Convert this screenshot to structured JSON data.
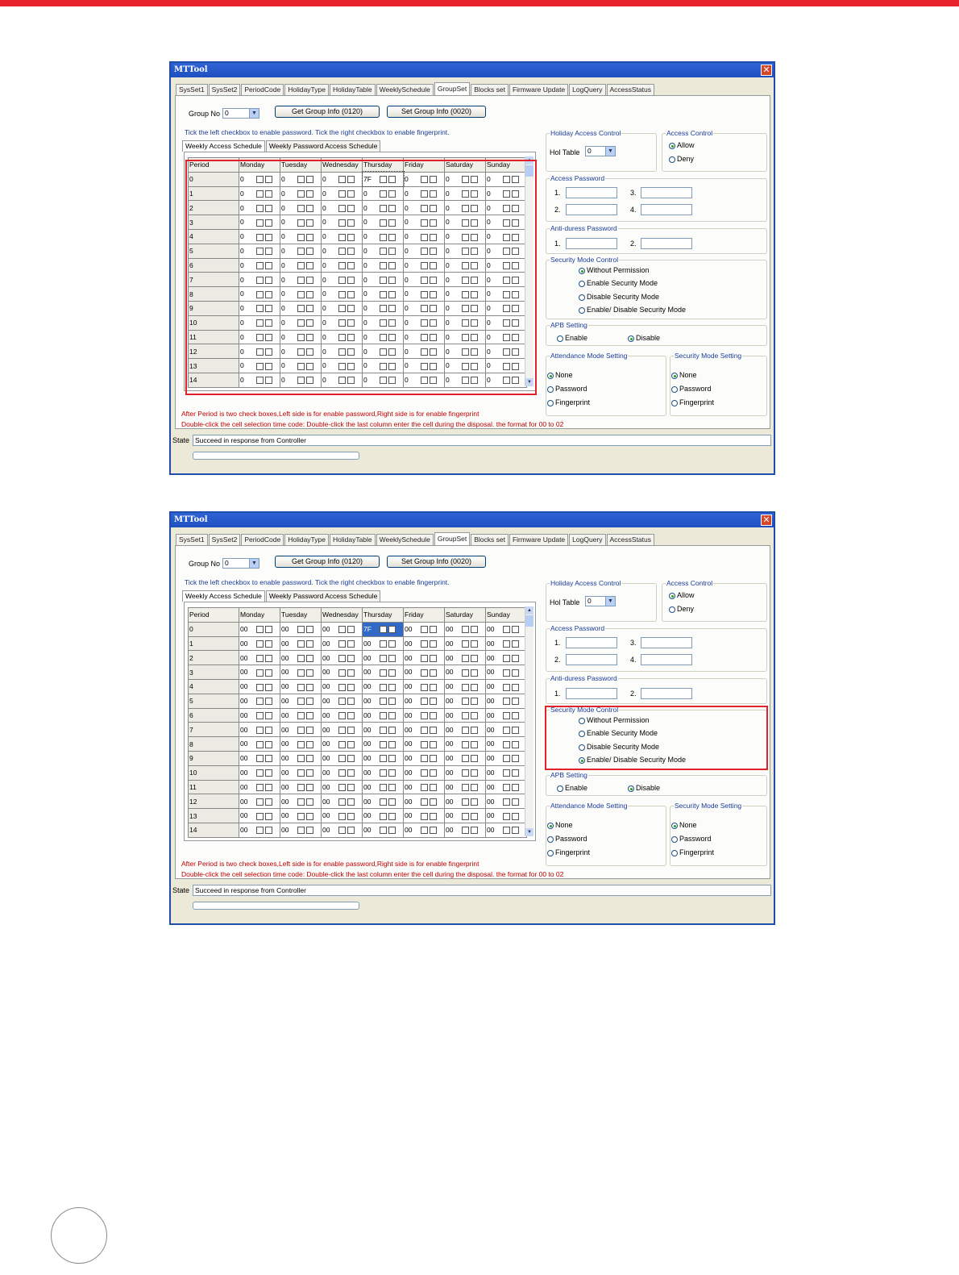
{
  "app_title": "MTTool",
  "tabs": [
    "SysSet1",
    "SysSet2",
    "PeriodCode",
    "HolidayType",
    "HolidayTable",
    "WeeklySchedule",
    "GroupSet",
    "Blocks set",
    "Firmware Update",
    "LogQuery",
    "AccessStatus"
  ],
  "active_tab": "GroupSet",
  "group_no_label": "Group No",
  "group_no_value": "0",
  "get_group_btn": "Get Group Info (0120)",
  "set_group_btn": "Set Group Info (0020)",
  "tick_hint": "Tick the left checkbox to enable password. Tick the right checkbox to enable fingerprint.",
  "subtabs": [
    "Weekly Access Schedule",
    "Weekly Password Access Schedule"
  ],
  "grid_headers": [
    "Period",
    "Monday",
    "Tuesday",
    "Wednesday",
    "Thursday",
    "Friday",
    "Saturday",
    "Sunday"
  ],
  "periods": [
    "0",
    "1",
    "2",
    "3",
    "4",
    "5",
    "6",
    "7",
    "8",
    "9",
    "10",
    "11",
    "12",
    "13",
    "14"
  ],
  "holiday_access": {
    "title": "Holiday Access Control",
    "hol_table_label": "Hol Table",
    "hol_table_value": "0"
  },
  "access_control": {
    "title": "Access Control",
    "allow": "Allow",
    "deny": "Deny"
  },
  "access_password": {
    "title": "Access Password",
    "n1": "1.",
    "n2": "2.",
    "n3": "3.",
    "n4": "4."
  },
  "anti_duress": {
    "title": "Anti-duress Password",
    "n1": "1.",
    "n2": "2."
  },
  "security_mode_control": {
    "title": "Security Mode Control",
    "opt1": "Without Permission",
    "opt2": "Enable Security Mode",
    "opt3": "Disable Security Mode",
    "opt4": "Enable/ Disable Security Mode"
  },
  "apb_setting": {
    "title": "APB Setting",
    "enable": "Enable",
    "disable": "Disable"
  },
  "attendance_mode": {
    "title": "Attendance Mode Setting",
    "none": "None",
    "password": "Password",
    "fingerprint": "Fingerprint"
  },
  "security_mode_setting": {
    "title": "Security Mode Setting",
    "none": "None",
    "password": "Password",
    "fingerprint": "Fingerprint"
  },
  "note1": "After Period is two check boxes,Left side is for enable password,Right side is for enable fingerprint",
  "note2": "Double-click the cell selection time code: Double-click the last column enter the cell during the disposal. the format for 00 to 02",
  "state_label": "State",
  "state_value": "Succeed in response from Controller",
  "windows": [
    {
      "cell_value": "0",
      "thursday_row0_value": "7F",
      "security_mode_selected": 1
    },
    {
      "cell_value": "00",
      "thursday_row0_value": "7F",
      "security_mode_selected": 4
    }
  ],
  "colors": {
    "accent_bar": "#e8232b",
    "titlebar": "#1f4fbf",
    "highlight": "#e0232b"
  }
}
